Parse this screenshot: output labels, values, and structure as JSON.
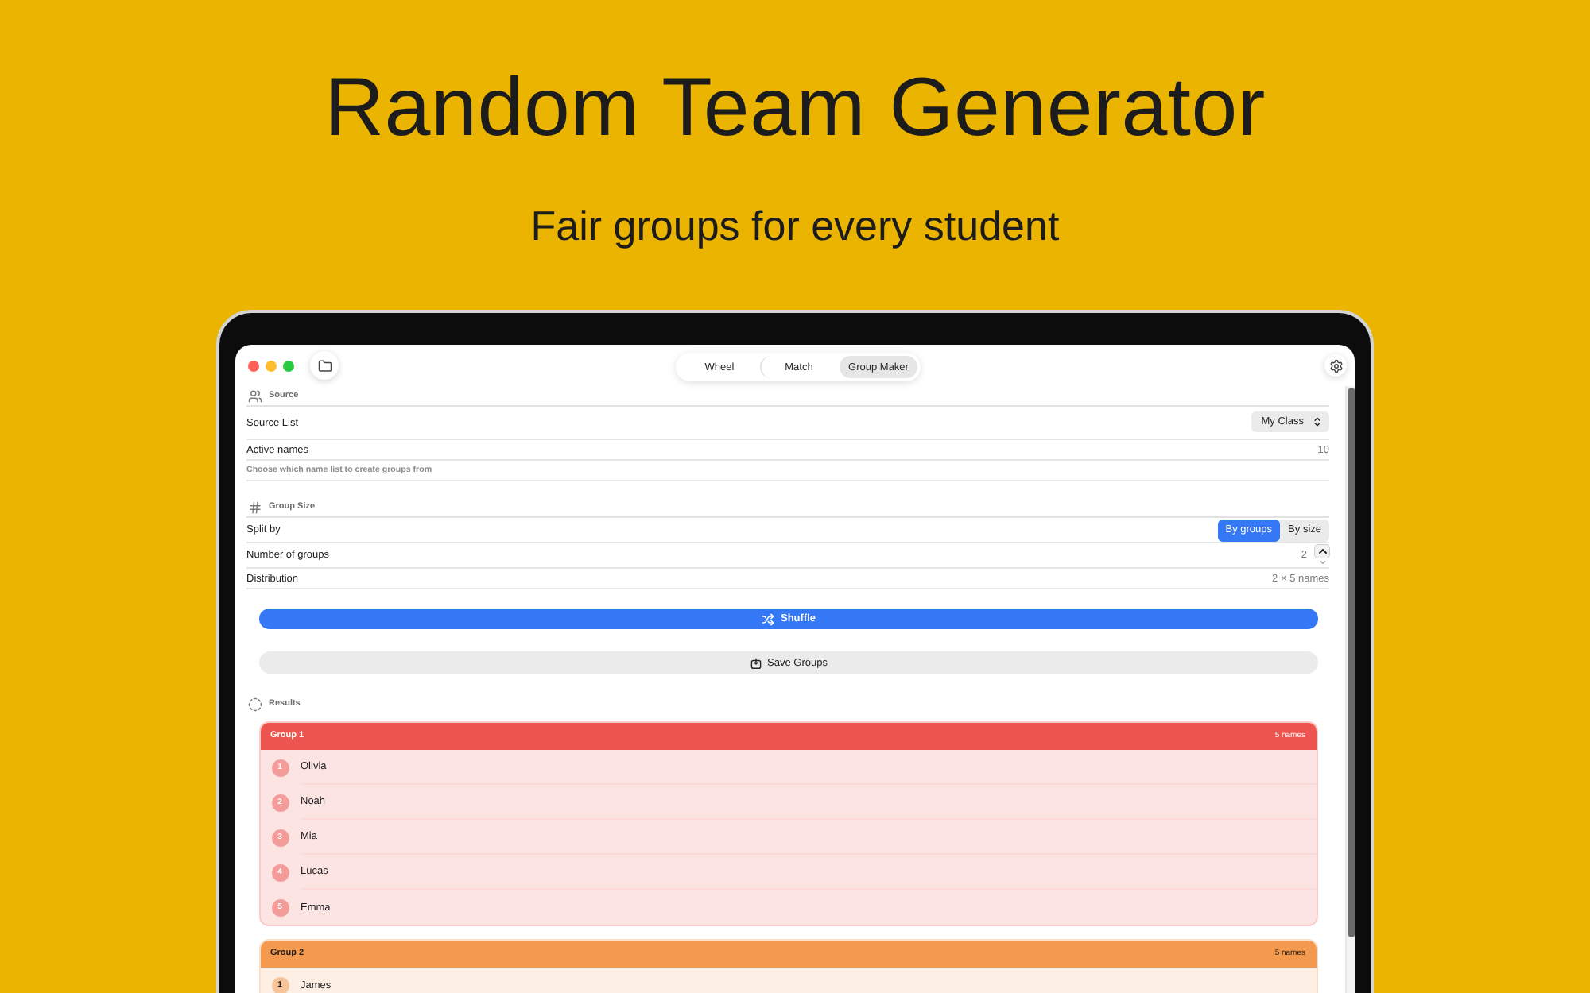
{
  "hero": {
    "title": "Random Team Generator",
    "subtitle": "Fair groups for every student"
  },
  "tabs": [
    {
      "label": "Wheel",
      "selected": false
    },
    {
      "label": "Match",
      "selected": false
    },
    {
      "label": "Group Maker",
      "selected": true
    }
  ],
  "source": {
    "title": "Source",
    "rows": [
      {
        "kind": "popup",
        "label": "Source List",
        "value": "My Class"
      },
      {
        "kind": "value",
        "label": "Active names",
        "value": "10"
      }
    ],
    "hint": "Choose which name list to create groups from"
  },
  "group_size": {
    "title": "Group Size",
    "rows": [
      {
        "kind": "segmented",
        "label": "Split by",
        "options": [
          {
            "label": "By groups",
            "selected": true
          },
          {
            "label": "By size",
            "selected": false
          }
        ]
      },
      {
        "kind": "stepper",
        "label": "Number of groups",
        "value": "2"
      },
      {
        "kind": "value",
        "label": "Distribution",
        "value": "2 × 5 names"
      }
    ]
  },
  "actions": [
    {
      "kind": "primary",
      "label": "Shuffle"
    },
    {
      "kind": "secondary",
      "label": "Save Groups"
    }
  ],
  "results": {
    "title": "Results",
    "groups": [
      {
        "name": "Group 1",
        "count": "5 names",
        "color": "#ec5550",
        "members": [
          {
            "number": "1",
            "name": "Olivia"
          },
          {
            "number": "2",
            "name": "Noah"
          },
          {
            "number": "3",
            "name": "Mia"
          },
          {
            "number": "4",
            "name": "Lucas"
          },
          {
            "number": "5",
            "name": "Emma"
          }
        ]
      },
      {
        "name": "Group 2",
        "count": "5 names",
        "color": "#f39a4f",
        "members": [
          {
            "number": "1",
            "name": "James"
          }
        ]
      }
    ]
  }
}
